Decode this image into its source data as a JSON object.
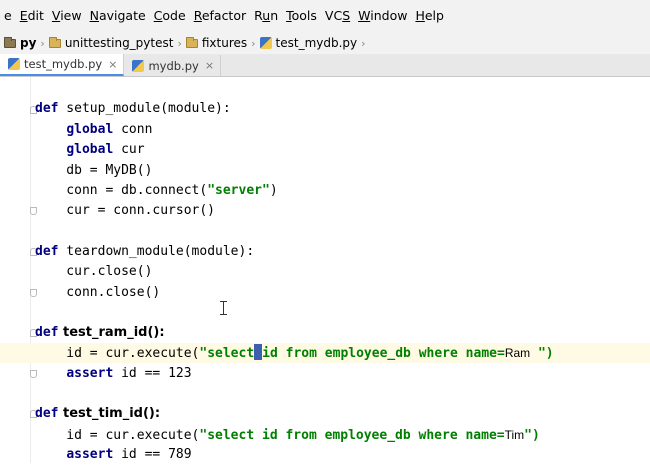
{
  "menu": {
    "items": [
      {
        "pre": "",
        "mn": "",
        "post": "e"
      },
      {
        "pre": "",
        "mn": "E",
        "post": "dit"
      },
      {
        "pre": "",
        "mn": "V",
        "post": "iew"
      },
      {
        "pre": "",
        "mn": "N",
        "post": "avigate"
      },
      {
        "pre": "",
        "mn": "C",
        "post": "ode"
      },
      {
        "pre": "",
        "mn": "R",
        "post": "efactor"
      },
      {
        "pre": "R",
        "mn": "u",
        "post": "n"
      },
      {
        "pre": "",
        "mn": "T",
        "post": "ools"
      },
      {
        "pre": "VC",
        "mn": "S",
        "post": ""
      },
      {
        "pre": "",
        "mn": "W",
        "post": "indow"
      },
      {
        "pre": "",
        "mn": "H",
        "post": "elp"
      }
    ]
  },
  "breadcrumb": {
    "items": [
      "py",
      "unittesting_pytest",
      "fixtures",
      "test_mydb.py"
    ],
    "separator": "›"
  },
  "tabs": [
    {
      "label": "test_mydb.py",
      "close": "×"
    },
    {
      "label": "mydb.py",
      "close": "×"
    }
  ],
  "code": {
    "l1": {
      "kw": "def",
      "rest": " setup_module(module):"
    },
    "l2": {
      "indent": "    ",
      "kw": "global",
      "rest": " conn"
    },
    "l3": {
      "indent": "    ",
      "kw": "global",
      "rest": " cur"
    },
    "l4": {
      "text": "    db = MyDB()"
    },
    "l5": {
      "pre": "    conn = db.connect(",
      "str": "\"server\"",
      "post": ")"
    },
    "l6": {
      "text": "    cur = conn.cursor()"
    },
    "l7": {
      "kw": "def",
      "rest": " teardown_module(module):"
    },
    "l8": {
      "text": "    cur.close()"
    },
    "l9": {
      "text": "    conn.close()"
    },
    "l10": {
      "kw": "def",
      "fn": " test_ram_id():"
    },
    "l11": {
      "pre": "    id = cur.execute(",
      "str1": "\"select",
      "str2": "id from employee_db where name=",
      "name": "Ram",
      "end": "\")"
    },
    "l12": {
      "indent": "    ",
      "kw": "assert",
      "rest": " id == 123"
    },
    "l13": {
      "kw": "def",
      "fn": " test_tim_id():"
    },
    "l14": {
      "pre": "    id = cur.execute(",
      "str": "\"select id from employee_db where name=",
      "name": "Tim",
      "end": "\")"
    },
    "l15": {
      "indent": "    ",
      "kw": "assert",
      "rest": " id == 789"
    }
  },
  "colors": {
    "keyword": "#000080",
    "string": "#008000",
    "caret_row": "#fffae3",
    "active_tab": "#4a8ee8"
  }
}
